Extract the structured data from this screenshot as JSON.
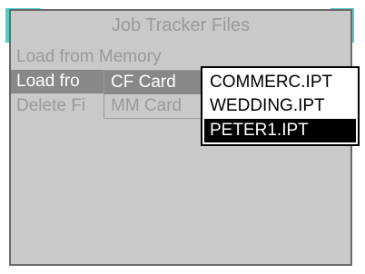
{
  "window": {
    "title": "Job Tracker Files"
  },
  "colors": {
    "accent": "#4fcfc7",
    "panel": "#c9c9c9",
    "highlight": "#888888",
    "selected": "#000000"
  },
  "menu": {
    "items": [
      {
        "label": "Load from Memory",
        "state": "disabled"
      },
      {
        "label": "Load fro",
        "state": "highlighted"
      },
      {
        "label": "Delete Fi",
        "state": "disabled"
      }
    ]
  },
  "source_menu": {
    "items": [
      {
        "label": "CF Card",
        "state": "highlighted"
      },
      {
        "label": "MM Card",
        "state": "disabled"
      }
    ]
  },
  "file_menu": {
    "items": [
      {
        "label": "COMMERC.IPT",
        "selected": false
      },
      {
        "label": "WEDDING.IPT",
        "selected": false
      },
      {
        "label": "PETER1.IPT",
        "selected": true
      }
    ]
  }
}
